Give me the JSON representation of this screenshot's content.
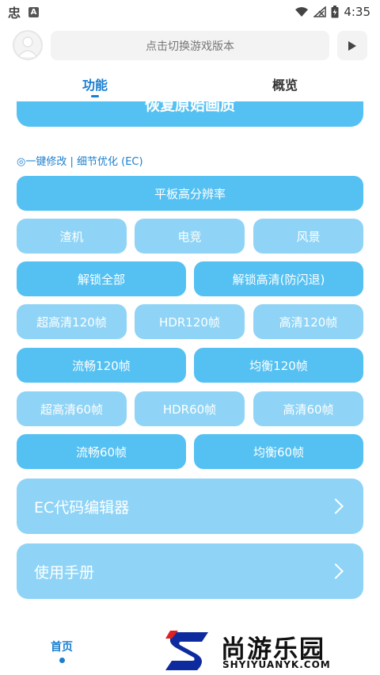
{
  "status_bar": {
    "left_glyph": "忠",
    "left_badge": "A",
    "time": "4:35"
  },
  "header": {
    "search_placeholder": "点击切换游戏版本",
    "play_icon": "play-icon"
  },
  "tabs": [
    {
      "label": "功能",
      "active": true
    },
    {
      "label": "概览",
      "active": false
    }
  ],
  "restore_button": "恢复原始画质",
  "section_title": "◎一键修改 | 细节优化 (EC)",
  "buttons": {
    "tablet_resolution": "平板高分辨率",
    "zhaji": "渣机",
    "dianjing": "电竞",
    "fengjing": "风景",
    "unlock_all": "解锁全部",
    "unlock_hd": "解锁高清(防闪退)",
    "uhd120": "超高清120帧",
    "hdr120": "HDR120帧",
    "hd120": "高清120帧",
    "smooth120": "流畅120帧",
    "balanced120": "均衡120帧",
    "uhd60": "超高清60帧",
    "hdr60": "HDR60帧",
    "hd60": "高清60帧",
    "smooth60": "流畅60帧",
    "balanced60": "均衡60帧"
  },
  "cards": {
    "ec_editor": "EC代码编辑器",
    "manual": "使用手册"
  },
  "bottom_nav": {
    "home": "首页"
  },
  "watermark": {
    "title": "尚游乐园",
    "subtitle": "SHYIYUANYK.COM"
  },
  "colors": {
    "accent": "#1a7fd0",
    "button_dark": "#55c1f2",
    "button_light": "#8fd4f6"
  }
}
